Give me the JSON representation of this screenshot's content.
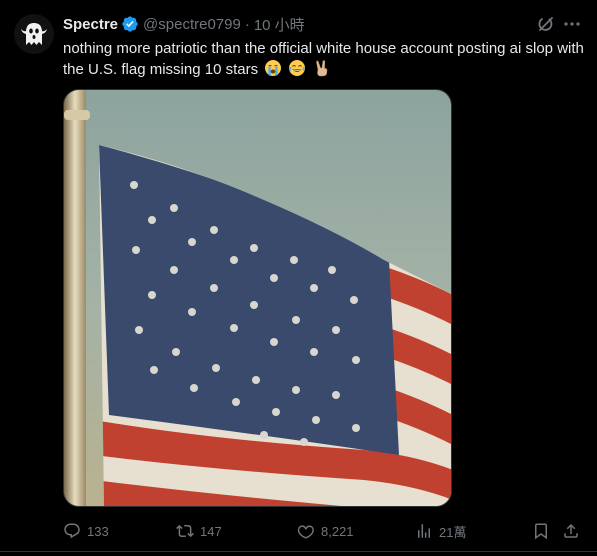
{
  "tweet": {
    "author_name": "Spectre",
    "handle": "@spectre0799",
    "separator": "·",
    "time": "10 小時",
    "text": "nothing more patriotic than the official white house account posting ai slop with the U.S. flag missing 10 stars",
    "emojis": [
      "loudly-crying-face",
      "face-with-tears-of-joy",
      "victory-hand"
    ],
    "media_description_icon": "us-flag-image"
  },
  "actions": {
    "replies": "133",
    "reposts": "147",
    "likes": "8,221",
    "views": "21萬"
  },
  "colors": {
    "background": "#000000",
    "text": "#e7e9ea",
    "muted": "#71767b",
    "verified": "#1d9bf0",
    "border": "#2f3336"
  }
}
